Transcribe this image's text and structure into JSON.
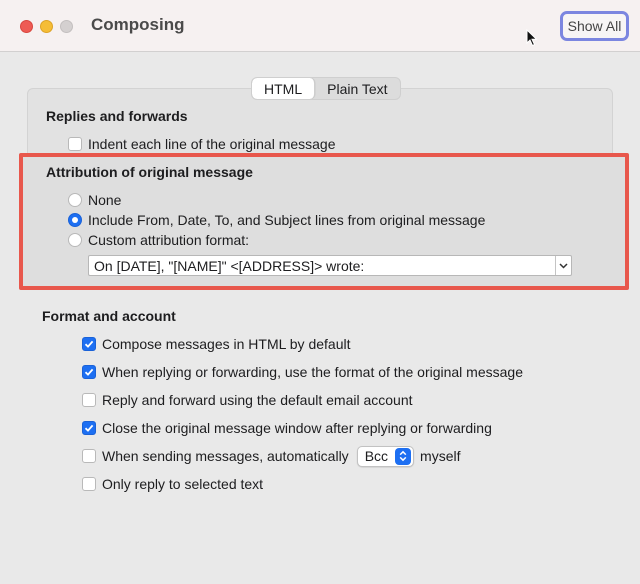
{
  "window": {
    "title": "Composing",
    "show_all": "Show All"
  },
  "tabs": [
    {
      "label": "HTML",
      "selected": true
    },
    {
      "label": "Plain Text",
      "selected": false
    }
  ],
  "replies": {
    "heading": "Replies and forwards",
    "indent_label": "Indent each line of the original message",
    "indent_checked": false
  },
  "attribution": {
    "heading": "Attribution of original message",
    "options": [
      {
        "label": "None",
        "selected": false
      },
      {
        "label": "Include From, Date, To, and Subject lines from original message",
        "selected": true
      },
      {
        "label": "Custom attribution format:",
        "selected": false
      }
    ],
    "custom_format": "On [DATE], \"[NAME]\" <[ADDRESS]> wrote:"
  },
  "format": {
    "heading": "Format and account",
    "items": [
      {
        "label": "Compose messages in HTML by default",
        "checked": true
      },
      {
        "label": "When replying or forwarding, use the format of the original message",
        "checked": true
      },
      {
        "label": "Reply and forward using the default email account",
        "checked": false
      },
      {
        "label": "Close the original message window after replying or forwarding",
        "checked": true
      },
      {
        "label": "When sending messages, automatically",
        "checked": false,
        "suffix": "myself"
      },
      {
        "label": "Only reply to selected text",
        "checked": false
      }
    ],
    "auto_select_value": "Bcc"
  },
  "colors": {
    "accent": "#1d6ff2",
    "highlight_border": "#e8574c",
    "show_all_ring": "#7b86e0"
  }
}
